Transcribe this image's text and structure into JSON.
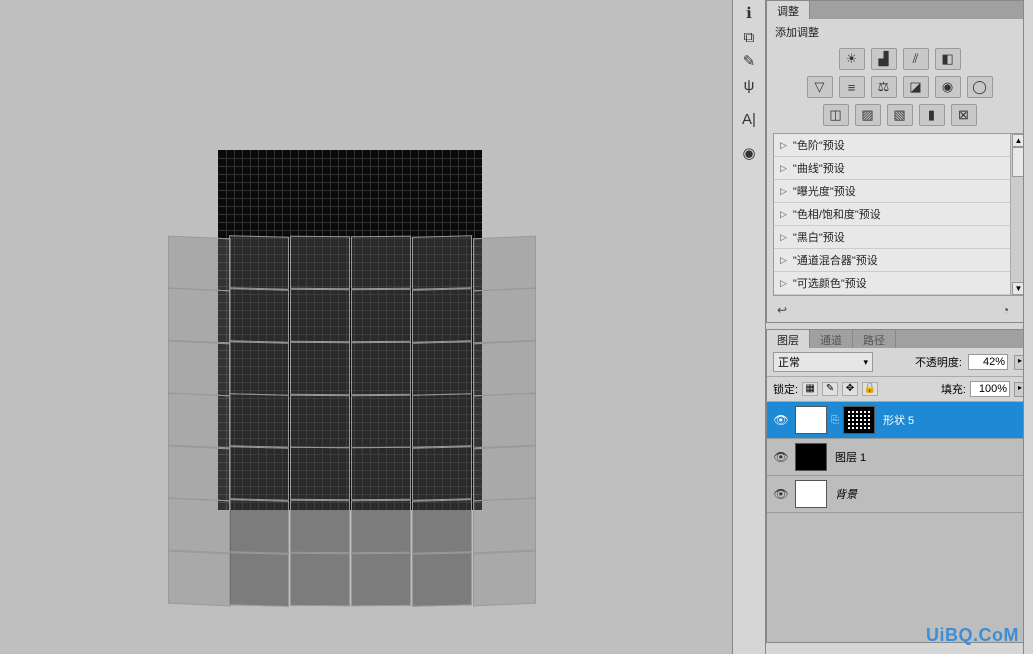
{
  "panels": {
    "adjustments": {
      "tab_label": "调整",
      "subtitle": "添加调整",
      "icons": {
        "r1": [
          "brightness-contrast",
          "levels",
          "curves",
          "exposure"
        ],
        "r2": [
          "vibrance",
          "hue-sat",
          "color-balance",
          "bw",
          "photo-filter",
          "channel-mixer"
        ],
        "r3": [
          "invert",
          "posterize",
          "threshold",
          "gradient-map",
          "selective-color"
        ]
      },
      "presets": [
        "\"色阶\"预设",
        "\"曲线\"预设",
        "\"曝光度\"预设",
        "\"色相/饱和度\"预设",
        "\"黑白\"预设",
        "\"通道混合器\"预设",
        "\"可选颜色\"预设"
      ]
    },
    "layers": {
      "tabs": [
        "图层",
        "通道",
        "路径"
      ],
      "blend_mode": "正常",
      "opacity_label": "不透明度:",
      "opacity_value": "42%",
      "lock_label": "锁定:",
      "fill_label": "填充:",
      "fill_value": "100%",
      "rows": [
        {
          "name": "形状 5",
          "selected": true,
          "has_mask": true
        },
        {
          "name": "图层 1",
          "selected": false,
          "has_mask": false
        },
        {
          "name": "背景",
          "selected": false,
          "has_mask": false,
          "italic": true
        }
      ]
    }
  },
  "watermark": "UiBQ.CoM"
}
